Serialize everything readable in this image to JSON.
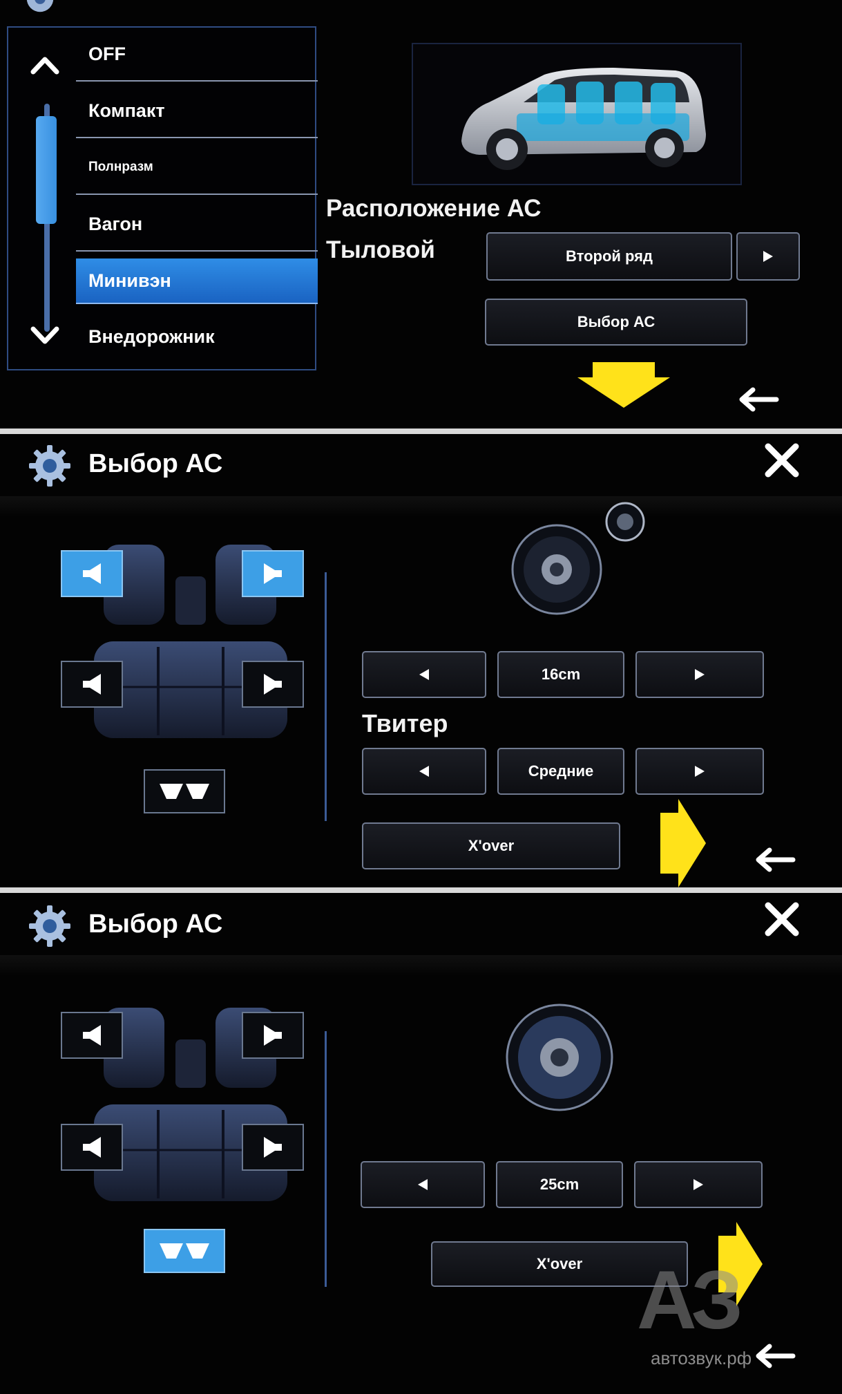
{
  "panel1": {
    "body_types": [
      {
        "label": "OFF",
        "selected": false
      },
      {
        "label": "Компакт",
        "selected": false
      },
      {
        "label": "Полнразм",
        "selected": false
      },
      {
        "label": "Вагон",
        "selected": false
      },
      {
        "label": "Минивэн",
        "selected": true
      },
      {
        "label": "Внедорожник",
        "selected": false
      }
    ],
    "placement_label": "Расположение АС",
    "rear_label": "Тыловой",
    "rear_value": "Второй ряд",
    "speaker_select_button": "Выбор АС"
  },
  "panel2": {
    "title": "Выбор АС",
    "size_value": "16cm",
    "tweeter_label": "Твитер",
    "tweeter_value": "Средние",
    "xover_button": "X'over"
  },
  "panel3": {
    "title": "Выбор АС",
    "size_value": "25cm",
    "xover_button": "X'over"
  },
  "watermark": {
    "mark": "АЗ",
    "domain": "автозвук.рф"
  },
  "colors": {
    "accent_blue": "#3d9fe6",
    "arrow_yellow": "#ffe21a",
    "frame_blue": "#2f4c82"
  },
  "icons": [
    "gear-icon",
    "close-icon",
    "back-arrow-icon",
    "chevron-up-icon",
    "chevron-down-icon",
    "speaker-left-icon",
    "speaker-right-icon",
    "subwoofer-icon"
  ]
}
